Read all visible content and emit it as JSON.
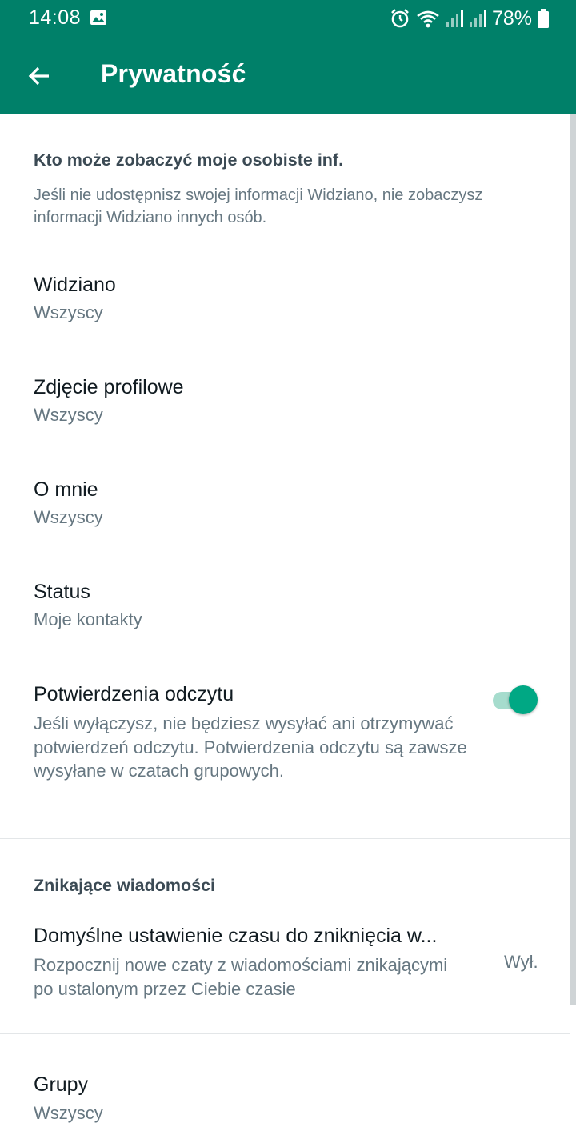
{
  "status_bar": {
    "time": "14:08",
    "battery": "78%",
    "icons": [
      "gallery-icon",
      "alarm-icon",
      "wifi-icon",
      "signal-icon",
      "signal-icon",
      "battery-icon"
    ]
  },
  "app_bar": {
    "title": "Prywatność",
    "back_icon": "arrow-left-icon"
  },
  "colors": {
    "primary": "#008069",
    "accent": "#00a884",
    "toggle_track": "#a6dccd",
    "secondary_text": "#667781"
  },
  "section_personal": {
    "header": "Kto może zobaczyć moje osobiste inf.",
    "description": "Jeśli nie udostępnisz swojej informacji Widziano, nie zobaczysz informacji Widziano innych osób."
  },
  "items": {
    "last_seen": {
      "title": "Widziano",
      "value": "Wszyscy"
    },
    "profile_photo": {
      "title": "Zdjęcie profilowe",
      "value": "Wszyscy"
    },
    "about": {
      "title": "O mnie",
      "value": "Wszyscy"
    },
    "status": {
      "title": "Status",
      "value": "Moje kontakty"
    },
    "read_receipts": {
      "title": "Potwierdzenia odczytu",
      "description": "Jeśli wyłączysz, nie będziesz wysyłać ani otrzymywać potwierdzeń odczytu. Potwierdzenia odczytu są zawsze wysyłane w czatach grupowych.",
      "enabled": true
    }
  },
  "section_disappearing": {
    "header": "Znikające wiadomości",
    "default_timer": {
      "title": "Domyślne ustawienie czasu do zniknięcia w...",
      "description": "Rozpocznij nowe czaty z wiadomościami znikającymi po ustalonym przez Ciebie czasie",
      "value": "Wył."
    }
  },
  "groups": {
    "title": "Grupy",
    "value": "Wszyscy"
  }
}
